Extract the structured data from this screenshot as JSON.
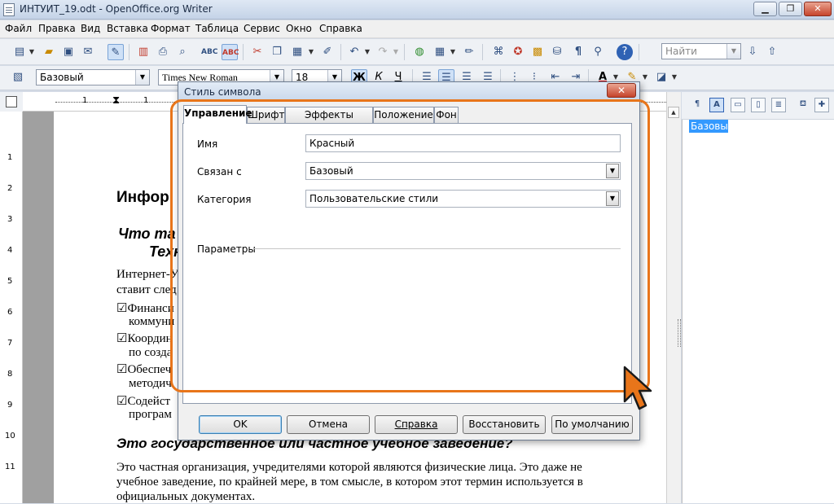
{
  "window": {
    "title": "ИНТУИТ_19.odt - OpenOffice.org Writer",
    "min_glyph": "▁",
    "max_glyph": "❐",
    "close_glyph": "✕"
  },
  "menu": [
    "Файл",
    "Правка",
    "Вид",
    "Вставка",
    "Формат",
    "Таблица",
    "Сервис",
    "Окно",
    "Справка"
  ],
  "toolbar": {
    "find_placeholder": "Найти",
    "style_value": "Базовый",
    "font_value": "Times New Roman",
    "size_value": "18",
    "bold": "Ж",
    "italic": "К",
    "underline": "Ч"
  },
  "document": {
    "heading1": "Инфор",
    "heading2_line1": "Что та",
    "heading2_line2": "Техн",
    "para1_line1": "Интернет-У",
    "para1_line2": "ставит след",
    "bullets": [
      {
        "line1": "☑Финанси",
        "line2": "коммуни"
      },
      {
        "line1": "☑Координ",
        "line2": "по созда"
      },
      {
        "line1": "☑Обеспеч",
        "line2": "методич"
      },
      {
        "line1": "☑Содейст",
        "line2": "програм"
      }
    ],
    "heading3": "Это государственное или частное учебное заведение?",
    "para2_line1": "Это частная организация, учредителями которой являются физические лица. Это даже не",
    "para2_line2": "учебное заведение, по крайней мере, в том смысле, в котором этот термин используется в",
    "para2_line3": "официальных документах."
  },
  "ruler": {
    "h_marks": [
      "1",
      "1"
    ],
    "v_marks": [
      "1",
      "2",
      "3",
      "4",
      "5",
      "6",
      "7",
      "8",
      "9",
      "10",
      "11"
    ]
  },
  "stylist": {
    "selected_item": "Базовый"
  },
  "dialog": {
    "title": "Стиль символа",
    "close_glyph": "✕",
    "tabs": [
      "Управление",
      "Шрифт",
      "Эффекты шрифта",
      "Положение",
      "Фон"
    ],
    "selected_tab": "Управление",
    "name_label": "Имя",
    "name_value": "Красный",
    "linked_label": "Связан с",
    "linked_value": "Базовый",
    "category_label": "Категория",
    "category_value": "Пользовательские стили",
    "params_label": "Параметры",
    "buttons": {
      "ok": "OK",
      "cancel": "Отмена",
      "help": "Справка",
      "reset": "Восстановить",
      "standard": "По умолчанию"
    }
  },
  "colors": {
    "highlight": "#e8751a",
    "selection": "#3399ff"
  }
}
